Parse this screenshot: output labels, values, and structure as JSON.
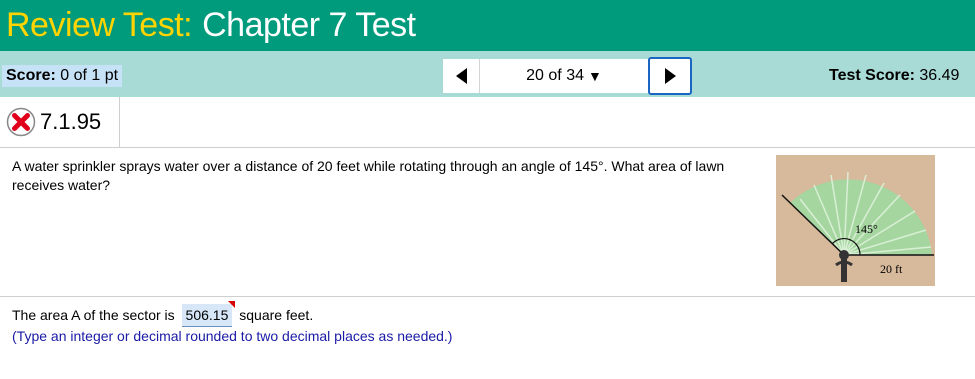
{
  "header": {
    "title_prefix": "Review Test:",
    "title_main": "Chapter 7 Test"
  },
  "scorebar": {
    "score_label": "Score:",
    "score_value": "0 of 1 pt",
    "nav_position": "20 of 34",
    "test_score_label": "Test Score:",
    "test_score_value": "36.49"
  },
  "problem": {
    "id": "7.1.95",
    "status_icon": "x-incorrect-icon",
    "question_text": "A water sprinkler sprays water over a distance of 20 feet while rotating through an angle of 145°. What area of lawn receives water?",
    "figure": {
      "angle_label": "145°",
      "distance_label": "20 ft"
    },
    "answer_prefix": "The area A of the sector is",
    "answer_value": "506.15",
    "answer_suffix": "square feet.",
    "hint": "(Type an integer or decimal rounded to two decimal places as needed.)"
  },
  "colors": {
    "header_bg": "#009a7c",
    "title_prefix": "#ffd400",
    "scorebar_bg": "#a8dad6",
    "accent_blue": "#1a66c2",
    "incorrect_red": "#e0001b",
    "figure_lawn": "#a5d6a0",
    "figure_ground": "#d7b99c"
  }
}
